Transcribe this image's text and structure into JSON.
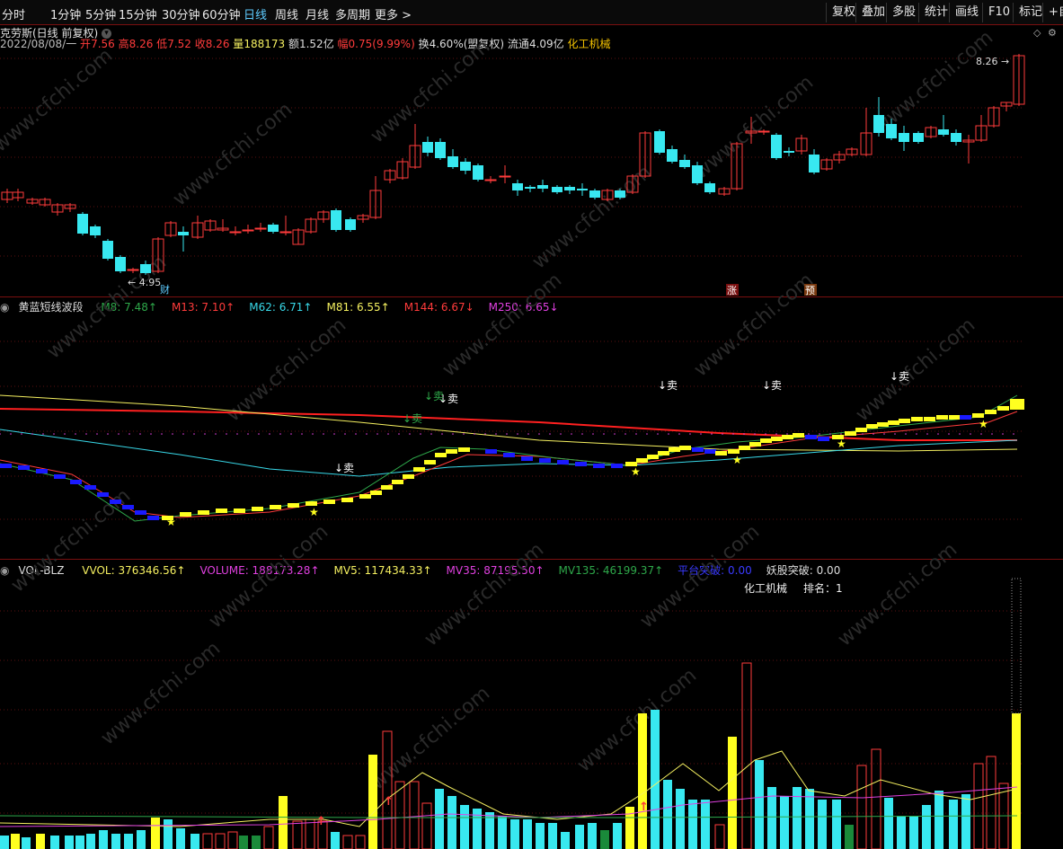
{
  "toolbar": {
    "periods": [
      "分时",
      "1分钟",
      "5分钟",
      "15分钟",
      "30分钟",
      "60分钟",
      "日线",
      "周线",
      "月线",
      "多周期",
      "更多 >"
    ],
    "active_period": "日线",
    "right_buttons": [
      "复权",
      "叠加",
      "多股",
      "统计",
      "画线",
      "F10",
      "标记",
      "+自"
    ]
  },
  "stock": {
    "title": "克劳斯(日线 前复权)",
    "date": "2022/08/08/一",
    "open_label": "开",
    "open": "7.56",
    "high_label": "高",
    "high": "8.26",
    "low_label": "低",
    "low": "7.52",
    "close_label": "收",
    "close": "8.26",
    "vol_label": "量",
    "vol": "188173",
    "amount_label": "额",
    "amount": "1.52亿",
    "change_label": "幅",
    "change": "0.75(9.99%)",
    "turnover_label": "换",
    "turnover": "4.60%(盟复权)",
    "float_label": "流通",
    "float": "4.09亿",
    "industry": "化工机械"
  },
  "price_chart": {
    "high_marker": "8.26",
    "low_marker": "4.95",
    "tags": [
      "财",
      "涨",
      "预"
    ]
  },
  "indicator1": {
    "name": "黄蓝短线波段",
    "items": [
      {
        "label": "M8: 7.48",
        "color": "#2ea84a",
        "arrow": "↑"
      },
      {
        "label": "M13: 7.10",
        "color": "#ff3b3b",
        "arrow": "↑"
      },
      {
        "label": "M62: 6.71",
        "color": "#38d8e8",
        "arrow": "↑"
      },
      {
        "label": "M81: 6.55",
        "color": "#f5f060",
        "arrow": "↑"
      },
      {
        "label": "M144: 6.67",
        "color": "#ff3b3b",
        "arrow": "↓"
      },
      {
        "label": "M250: 6.65",
        "color": "#e040e0",
        "arrow": "↓"
      }
    ],
    "sell_label": "卖"
  },
  "indicator2": {
    "name": "VOL-BLZ",
    "items": [
      {
        "label": "VVOL: 376346.56",
        "color": "#f5f060",
        "arrow": "↑"
      },
      {
        "label": "VOLUME: 188173.28",
        "color": "#e040e0",
        "arrow": "↑"
      },
      {
        "label": "MV5: 117434.33",
        "color": "#f5f060",
        "arrow": "↑"
      },
      {
        "label": "MV35: 87195.50",
        "color": "#e040e0",
        "arrow": "↑"
      },
      {
        "label": "MV135: 46199.37",
        "color": "#2ea84a",
        "arrow": "↑"
      },
      {
        "label": "平台突破: 0.00",
        "color": "#3a3aff",
        "arrow": ""
      },
      {
        "label": "妖股突破: 0.00",
        "color": "#dddddd",
        "arrow": ""
      }
    ],
    "industry": "化工机械",
    "rank_label": "排名：1"
  },
  "watermark": "www.cfchi.com",
  "colors": {
    "up": "#ff3b3b",
    "down": "#38e8f0",
    "yellow": "#ffff20",
    "blue": "#1a1aff",
    "bg": "#000000"
  }
}
